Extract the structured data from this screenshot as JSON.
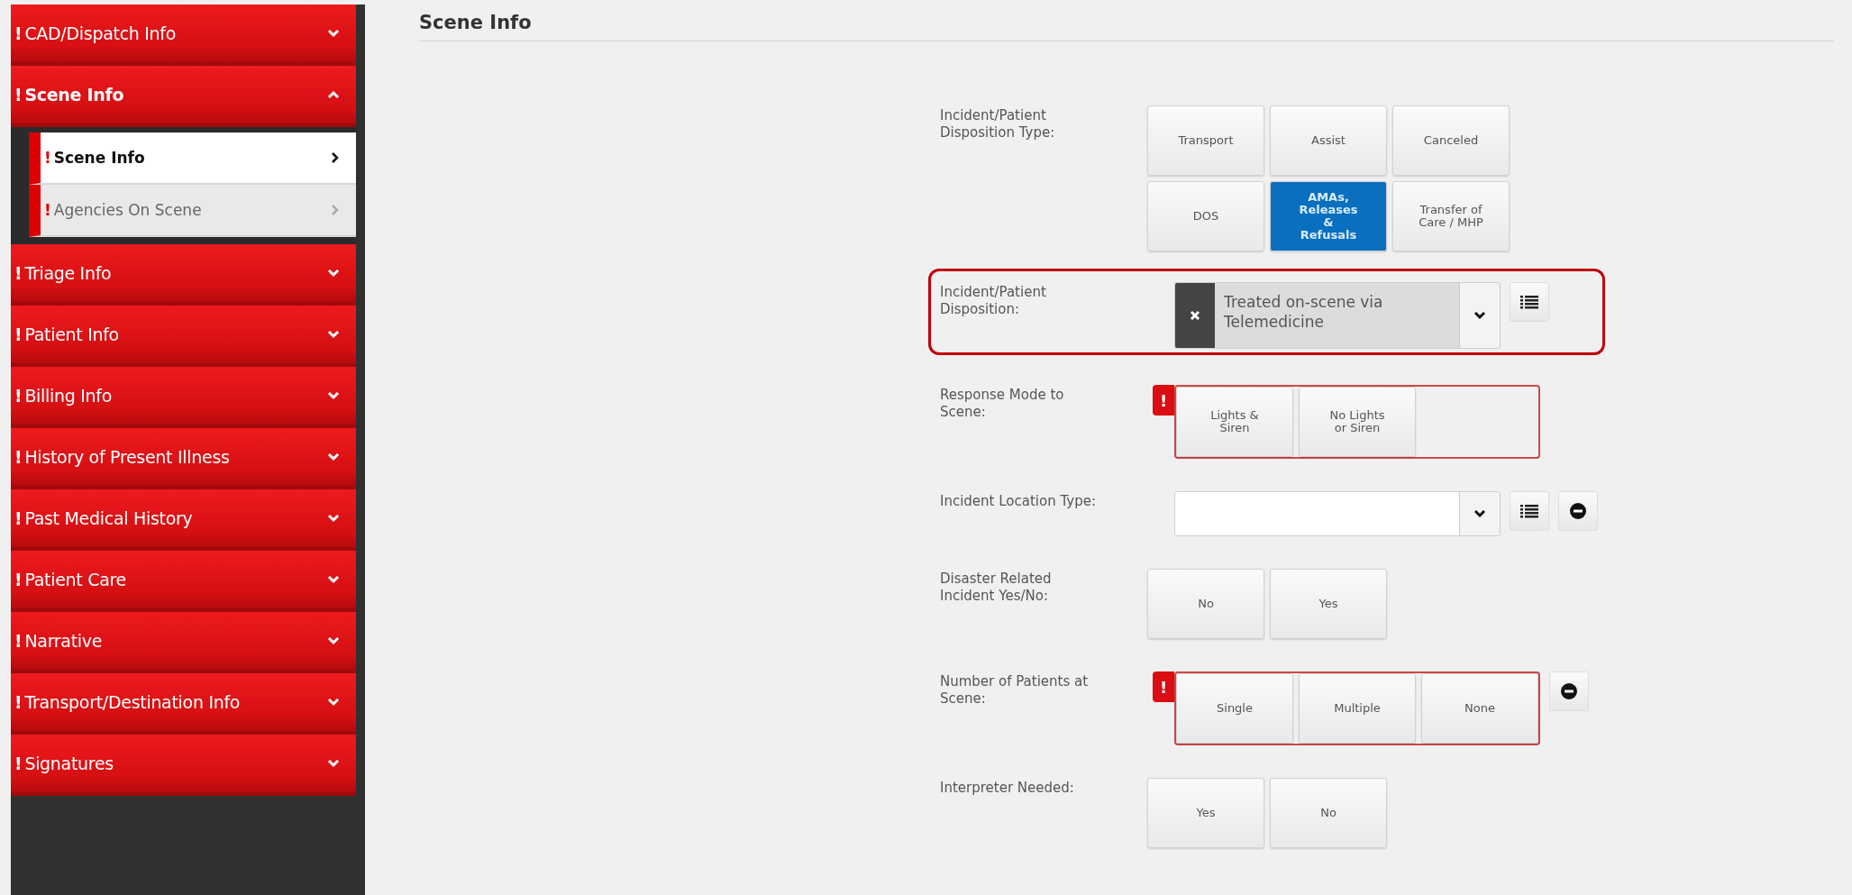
{
  "sidebar": {
    "sections": [
      {
        "flag": "!",
        "label": "CAD/Dispatch Info",
        "expanded": false
      },
      {
        "flag": "!",
        "label": "Scene Info",
        "expanded": true,
        "children": [
          {
            "flag": "!",
            "label": "Scene Info",
            "selected": true
          },
          {
            "flag": "!",
            "label": "Agencies On Scene",
            "selected": false
          }
        ]
      },
      {
        "flag": "!",
        "label": "Triage Info",
        "expanded": false
      },
      {
        "flag": "!",
        "label": "Patient Info",
        "expanded": false
      },
      {
        "flag": "!",
        "label": "Billing Info",
        "expanded": false
      },
      {
        "flag": "!",
        "label": "History of Present Illness",
        "expanded": false
      },
      {
        "flag": "!",
        "label": "Past Medical History",
        "expanded": false
      },
      {
        "flag": "!",
        "label": "Patient Care",
        "expanded": false
      },
      {
        "flag": "!",
        "label": "Narrative",
        "expanded": false
      },
      {
        "flag": "!",
        "label": "Transport/Destination Info",
        "expanded": false
      },
      {
        "flag": "!",
        "label": "Signatures",
        "expanded": false
      }
    ]
  },
  "page": {
    "title": "Scene Info"
  },
  "fields": [
    {
      "kind": "buttons",
      "label": "Incident/Patient Disposition Type:",
      "options": [
        {
          "label": "Transport",
          "selected": false
        },
        {
          "label": "Assist",
          "selected": false
        },
        {
          "label": "Canceled",
          "selected": false
        },
        {
          "label": "DOS",
          "selected": false
        },
        {
          "label": "AMAs, Releases & Refusals",
          "selected": true
        },
        {
          "label": "Transfer of Care / MHP",
          "selected": false
        }
      ]
    },
    {
      "kind": "select",
      "label": "Incident/Patient Disposition:",
      "highlighted": true,
      "value": "Treated on-scene via Telemedicine",
      "clearable": true
    },
    {
      "kind": "buttons",
      "label": "Response Mode to Scene:",
      "required": true,
      "alert": "!",
      "options": [
        {
          "label": "Lights & Siren",
          "selected": false
        },
        {
          "label": "No Lights or Siren",
          "selected": false
        }
      ]
    },
    {
      "kind": "select",
      "label": "Incident Location Type:",
      "remove": true
    },
    {
      "kind": "buttons",
      "label": "Disaster Related Incident Yes/No:",
      "options": [
        {
          "label": "No",
          "selected": false
        },
        {
          "label": "Yes",
          "selected": false
        }
      ]
    },
    {
      "kind": "buttons",
      "label": "Number of Patients at Scene:",
      "required": true,
      "alert": "!",
      "remove": true,
      "options": [
        {
          "label": "Single",
          "selected": false
        },
        {
          "label": "Multiple",
          "selected": false
        },
        {
          "label": "None",
          "selected": false
        }
      ]
    },
    {
      "kind": "buttons",
      "label": "Interpreter Needed:",
      "options": [
        {
          "label": "Yes",
          "selected": false
        },
        {
          "label": "No",
          "selected": false
        }
      ]
    }
  ]
}
